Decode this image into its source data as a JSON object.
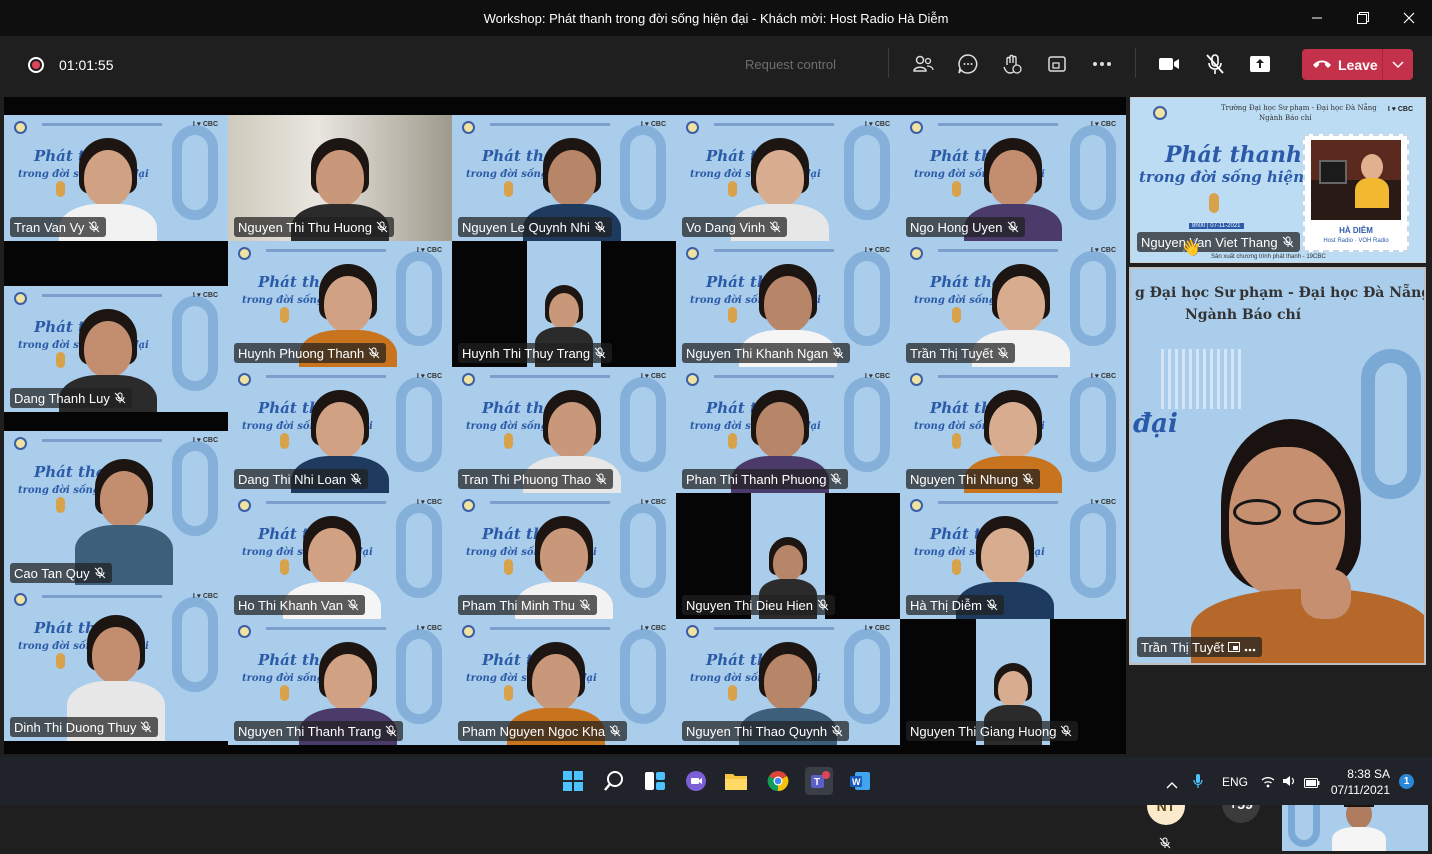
{
  "window": {
    "title": "Workshop: Phát thanh trong đời sống hiện đại - Khách mời: Host Radio Hà Diễm"
  },
  "toolbar": {
    "timer": "01:01:55",
    "request_control": "Request control",
    "leave_label": "Leave"
  },
  "background": {
    "line1": "Phát thanh",
    "line2": "trong đời sống hiện đại",
    "school": "Trường Đại học Sư phạm - Đại học Đà Nẵng",
    "faculty": "Ngành Báo chí"
  },
  "participants": [
    {
      "name": "Tran Van Vy"
    },
    {
      "name": "Nguyen Thi Thu Huong"
    },
    {
      "name": "Nguyen Le Quynh Nhi"
    },
    {
      "name": "Vo Dang Vinh"
    },
    {
      "name": "Ngo Hong Uyen"
    },
    {
      "name": "Huynh Phuong Thanh"
    },
    {
      "name": "Huynh Thi Thuy Trang"
    },
    {
      "name": "Nguyen Thi Khanh Ngan"
    },
    {
      "name": "Trần Thị Tuyết"
    },
    {
      "name": "Dang Thanh Luy"
    },
    {
      "name": "Dang Thi Nhi Loan"
    },
    {
      "name": "Tran Thi Phuong Thao"
    },
    {
      "name": "Phan Thi Thanh Phuong"
    },
    {
      "name": "Nguyen Thi Nhung"
    },
    {
      "name": "Cao Tan Quy"
    },
    {
      "name": "Ho Thi Khanh Van"
    },
    {
      "name": "Pham Thi Minh Thu"
    },
    {
      "name": "Nguyen Thi Dieu Hien"
    },
    {
      "name": "Hà Thị Diễm"
    },
    {
      "name": "Dinh Thi Duong Thuy"
    },
    {
      "name": "Nguyen Thi Thanh Trang"
    },
    {
      "name": "Pham Nguyen Ngoc Kha"
    },
    {
      "name": "Nguyen Thi Thao Quynh"
    },
    {
      "name": "Nguyen Thi Giang Huong"
    }
  ],
  "share": {
    "presenter": "Nguyen Van Viet Thang",
    "poster_date": "8h00 | 07-11-2021",
    "guest_name": "HÀ DIỄM",
    "guest_role": "Host Radio · VOH Radio",
    "footer": "Sản xuất chương trình phát thanh - 19CBC",
    "cbc": "I ♥ CBC"
  },
  "spotlight": {
    "name": "Trần Thị Tuyết",
    "school": "g Đại học Sư phạm - Đại học Đà Nẵng",
    "faculty": "Ngành Báo chí",
    "deco": "đại"
  },
  "overflow": {
    "initials": "NT",
    "more_count": "+59"
  },
  "taskbar": {
    "lang": "ENG",
    "time": "8:38 SA",
    "date": "07/11/2021",
    "notifications": "1"
  }
}
